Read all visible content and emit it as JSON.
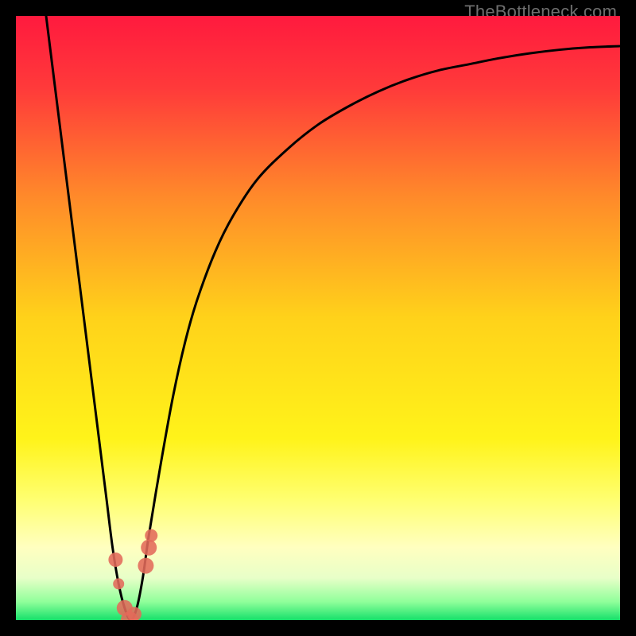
{
  "watermark": "TheBottleneck.com",
  "chart_data": {
    "type": "line",
    "title": "",
    "xlabel": "",
    "ylabel": "",
    "xlim": [
      0,
      100
    ],
    "ylim": [
      0,
      100
    ],
    "background_gradient": {
      "stops": [
        {
          "offset": 0.0,
          "color": "#ff1a3e"
        },
        {
          "offset": 0.12,
          "color": "#ff3a3a"
        },
        {
          "offset": 0.3,
          "color": "#ff8a2a"
        },
        {
          "offset": 0.5,
          "color": "#ffd21a"
        },
        {
          "offset": 0.7,
          "color": "#fff31a"
        },
        {
          "offset": 0.8,
          "color": "#ffff70"
        },
        {
          "offset": 0.88,
          "color": "#ffffc0"
        },
        {
          "offset": 0.93,
          "color": "#e8ffc8"
        },
        {
          "offset": 0.97,
          "color": "#8fff9a"
        },
        {
          "offset": 1.0,
          "color": "#16e06a"
        }
      ]
    },
    "series": [
      {
        "name": "bottleneck-curve",
        "x": [
          5,
          6,
          7,
          8,
          9,
          10,
          11,
          12,
          13,
          14,
          15,
          16,
          17,
          18,
          19,
          20,
          21,
          22,
          24,
          26,
          28,
          30,
          33,
          36,
          40,
          45,
          50,
          55,
          60,
          65,
          70,
          75,
          80,
          85,
          90,
          95,
          100
        ],
        "y": [
          100,
          92,
          84,
          76,
          68,
          60,
          52,
          44,
          36,
          28,
          20,
          12,
          6,
          2,
          0,
          2,
          7,
          14,
          26,
          37,
          46,
          53,
          61,
          67,
          73,
          78,
          82,
          85,
          87.5,
          89.5,
          91,
          92,
          93,
          93.8,
          94.4,
          94.8,
          95
        ]
      }
    ],
    "points": {
      "name": "highlighted-points",
      "color": "#e26a5a",
      "items": [
        {
          "x": 16.5,
          "y": 10,
          "r": 9
        },
        {
          "x": 17.0,
          "y": 6,
          "r": 7
        },
        {
          "x": 18.0,
          "y": 2,
          "r": 10
        },
        {
          "x": 18.8,
          "y": 0,
          "r": 11
        },
        {
          "x": 19.6,
          "y": 1,
          "r": 9
        },
        {
          "x": 21.5,
          "y": 9,
          "r": 10
        },
        {
          "x": 22.0,
          "y": 12,
          "r": 10
        },
        {
          "x": 22.4,
          "y": 14,
          "r": 8
        }
      ]
    }
  }
}
